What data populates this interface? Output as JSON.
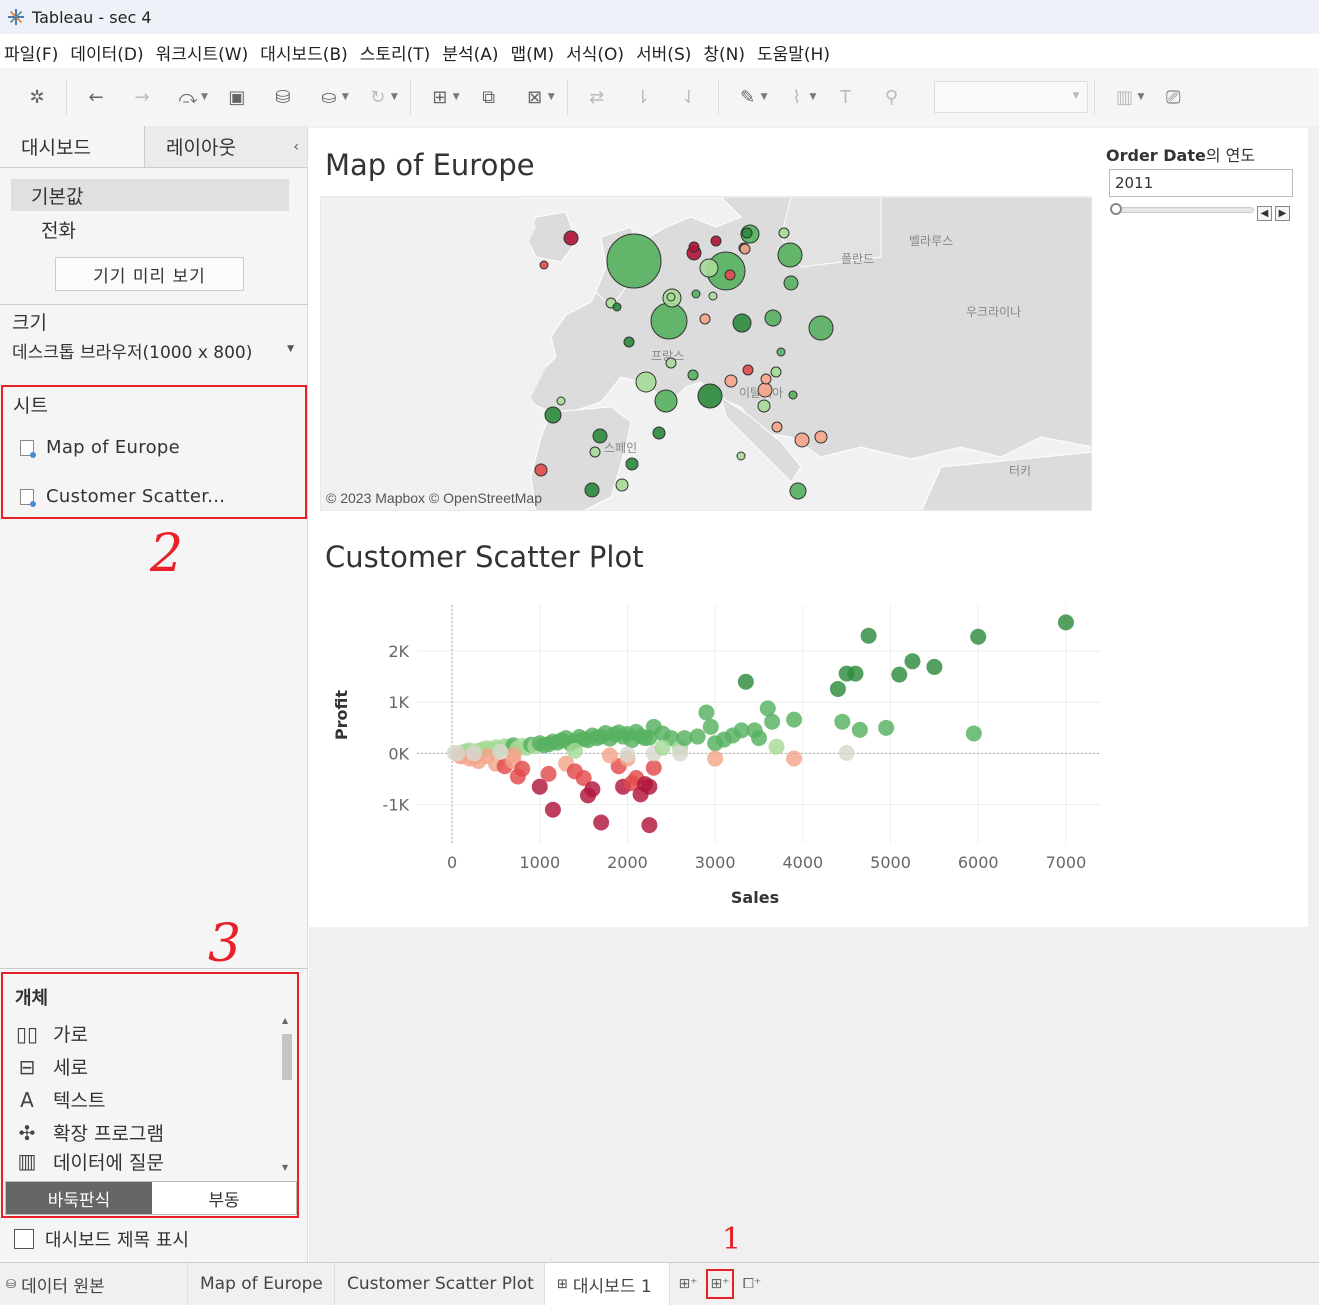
{
  "window": {
    "title": "Tableau - sec 4"
  },
  "menu": [
    "파일(F)",
    "데이터(D)",
    "워크시트(W)",
    "대시보드(B)",
    "스토리(T)",
    "분석(A)",
    "맵(M)",
    "서식(O)",
    "서버(S)",
    "창(N)",
    "도움말(H)"
  ],
  "left_panel": {
    "tab_dashboard": "대시보드",
    "tab_layout": "레이아웃",
    "device_default": "기본값",
    "device_phone": "전화",
    "device_preview": "기기 미리 보기",
    "size_label": "크기",
    "size_value": "데스크톱 브라우저(1000 x 800)",
    "sheets_label": "시트",
    "sheets": [
      "Map of Europe",
      "Customer Scatter..."
    ],
    "objects_label": "개체",
    "objects": [
      "가로",
      "세로",
      "텍스트",
      "확장 프로그램",
      "데이터에 질문"
    ],
    "tiled": "바둑판식",
    "floating": "부동",
    "show_title": "대시보드 제목 표시"
  },
  "annotations": {
    "a1": "1",
    "a2": "2",
    "a3": "3"
  },
  "dashboard": {
    "map_title": "Map of Europe",
    "map_attribution": "© 2023 Mapbox © OpenStreetMap",
    "map_labels": [
      "폴란드",
      "벨라루스",
      "우크라이나",
      "프랑스",
      "이탈리아",
      "스페인",
      "터키"
    ],
    "scatter_title": "Customer Scatter Plot",
    "filter": {
      "label_bold": "Order Date",
      "label_rest": "의 연도",
      "value": "2011"
    }
  },
  "colors": {
    "pos_dark": "#2e8b3d",
    "pos_mid": "#57b160",
    "pos_light": "#a6db97",
    "neutral": "#d8d8d0",
    "neg_light": "#f4a58a",
    "neg_mid": "#e24b4b",
    "neg_dark": "#b0163a",
    "annotation": "#e8202a"
  },
  "chart_data": {
    "type": "scatter",
    "title": "Customer Scatter Plot",
    "xlabel": "Sales",
    "ylabel": "Profit",
    "xlim": [
      -400,
      7400
    ],
    "ylim": [
      -1750,
      2900
    ],
    "x_ticks": [
      "0",
      "1000",
      "2000",
      "3000",
      "4000",
      "5000",
      "6000",
      "7000"
    ],
    "y_ticks": [
      "2K",
      "1K",
      "0K",
      "-1K"
    ],
    "y_tick_values": [
      2000,
      1000,
      0,
      -1000
    ],
    "x_tick_values": [
      0,
      1000,
      2000,
      3000,
      4000,
      5000,
      6000,
      7000
    ],
    "color_encoding": "Profit (diverging red-green)",
    "points": [
      [
        30,
        10
      ],
      [
        80,
        -30
      ],
      [
        120,
        20
      ],
      [
        150,
        40
      ],
      [
        200,
        60
      ],
      [
        250,
        -80
      ],
      [
        300,
        50
      ],
      [
        350,
        80
      ],
      [
        400,
        100
      ],
      [
        450,
        70
      ],
      [
        500,
        120
      ],
      [
        550,
        90
      ],
      [
        600,
        140
      ],
      [
        650,
        130
      ],
      [
        700,
        160
      ],
      [
        750,
        100
      ],
      [
        800,
        150
      ],
      [
        850,
        110
      ],
      [
        900,
        170
      ],
      [
        950,
        140
      ],
      [
        1000,
        200
      ],
      [
        1050,
        160
      ],
      [
        1100,
        180
      ],
      [
        1150,
        230
      ],
      [
        1200,
        210
      ],
      [
        1250,
        260
      ],
      [
        1300,
        300
      ],
      [
        1350,
        190
      ],
      [
        1400,
        240
      ],
      [
        1450,
        320
      ],
      [
        1500,
        280
      ],
      [
        1550,
        260
      ],
      [
        1600,
        350
      ],
      [
        1650,
        300
      ],
      [
        1700,
        330
      ],
      [
        1750,
        400
      ],
      [
        1800,
        290
      ],
      [
        1850,
        370
      ],
      [
        1900,
        410
      ],
      [
        1950,
        330
      ],
      [
        2000,
        380
      ],
      [
        2050,
        260
      ],
      [
        2100,
        420
      ],
      [
        2150,
        340
      ],
      [
        2200,
        300
      ],
      [
        2250,
        310
      ],
      [
        2300,
        520
      ],
      [
        2400,
        390
      ],
      [
        2500,
        300
      ],
      [
        2600,
        110
      ],
      [
        2650,
        300
      ],
      [
        2800,
        330
      ],
      [
        2900,
        800
      ],
      [
        2950,
        520
      ],
      [
        3000,
        200
      ],
      [
        3100,
        270
      ],
      [
        3200,
        350
      ],
      [
        3300,
        450
      ],
      [
        3350,
        1400
      ],
      [
        3450,
        450
      ],
      [
        3500,
        300
      ],
      [
        3600,
        880
      ],
      [
        3650,
        620
      ],
      [
        3700,
        130
      ],
      [
        3900,
        660
      ],
      [
        4400,
        1260
      ],
      [
        4500,
        1560
      ],
      [
        4450,
        620
      ],
      [
        4600,
        1560
      ],
      [
        4650,
        460
      ],
      [
        4750,
        2300
      ],
      [
        4950,
        500
      ],
      [
        5100,
        1540
      ],
      [
        5250,
        1800
      ],
      [
        5500,
        1690
      ],
      [
        5950,
        390
      ],
      [
        6000,
        2280
      ],
      [
        7000,
        2560
      ],
      [
        100,
        -60
      ],
      [
        200,
        -100
      ],
      [
        300,
        -150
      ],
      [
        400,
        -50
      ],
      [
        500,
        -200
      ],
      [
        600,
        -250
      ],
      [
        700,
        -150
      ],
      [
        750,
        -450
      ],
      [
        800,
        -300
      ],
      [
        1000,
        -650
      ],
      [
        1100,
        -400
      ],
      [
        1150,
        -1100
      ],
      [
        1300,
        -200
      ],
      [
        1400,
        -350
      ],
      [
        1500,
        -480
      ],
      [
        1550,
        -820
      ],
      [
        1600,
        -700
      ],
      [
        1700,
        -1350
      ],
      [
        1900,
        -250
      ],
      [
        1950,
        -650
      ],
      [
        2000,
        -100
      ],
      [
        2050,
        -580
      ],
      [
        2100,
        -480
      ],
      [
        2150,
        -800
      ],
      [
        2200,
        -600
      ],
      [
        2250,
        -1400
      ],
      [
        2250,
        -650
      ],
      [
        2300,
        -280
      ],
      [
        2000,
        -20
      ],
      [
        2300,
        0
      ],
      [
        2400,
        110
      ],
      [
        2600,
        0
      ],
      [
        3000,
        -100
      ],
      [
        3900,
        -100
      ],
      [
        4500,
        10
      ],
      [
        1800,
        -40
      ],
      [
        1400,
        50
      ],
      [
        700,
        -30
      ],
      [
        550,
        30
      ],
      [
        250,
        0
      ],
      [
        60,
        0
      ]
    ]
  }
}
